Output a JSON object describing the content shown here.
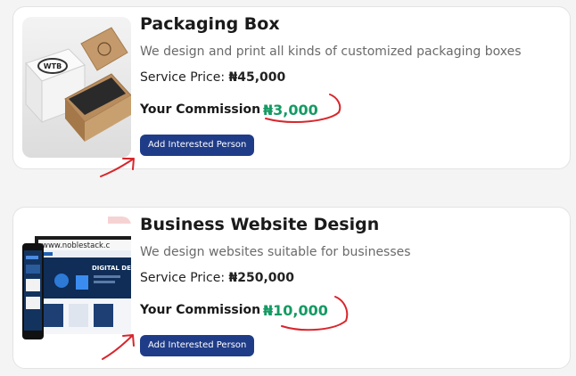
{
  "cards": [
    {
      "title": "Packaging Box",
      "description": "We design and print all kinds of customized packaging boxes",
      "price_label": "Service Price:",
      "price_value": "₦45,000",
      "commission_label": "Your Commission",
      "commission_value": "₦3,000",
      "button_label": "Add Interested Person",
      "image_text": "WTB"
    },
    {
      "title": "Business Website Design",
      "description": "We design websites suitable for businesses",
      "price_label": "Service Price:",
      "price_value": "₦250,000",
      "commission_label": "Your Commission",
      "commission_value": "₦10,000",
      "button_label": "Add Interested Person",
      "image_text": "www.noblestack.c",
      "image_banner": "DIGITAL DESIG"
    }
  ],
  "colors": {
    "button": "#1f3c88",
    "commission": "#159a63",
    "annotation": "#d8262c"
  }
}
